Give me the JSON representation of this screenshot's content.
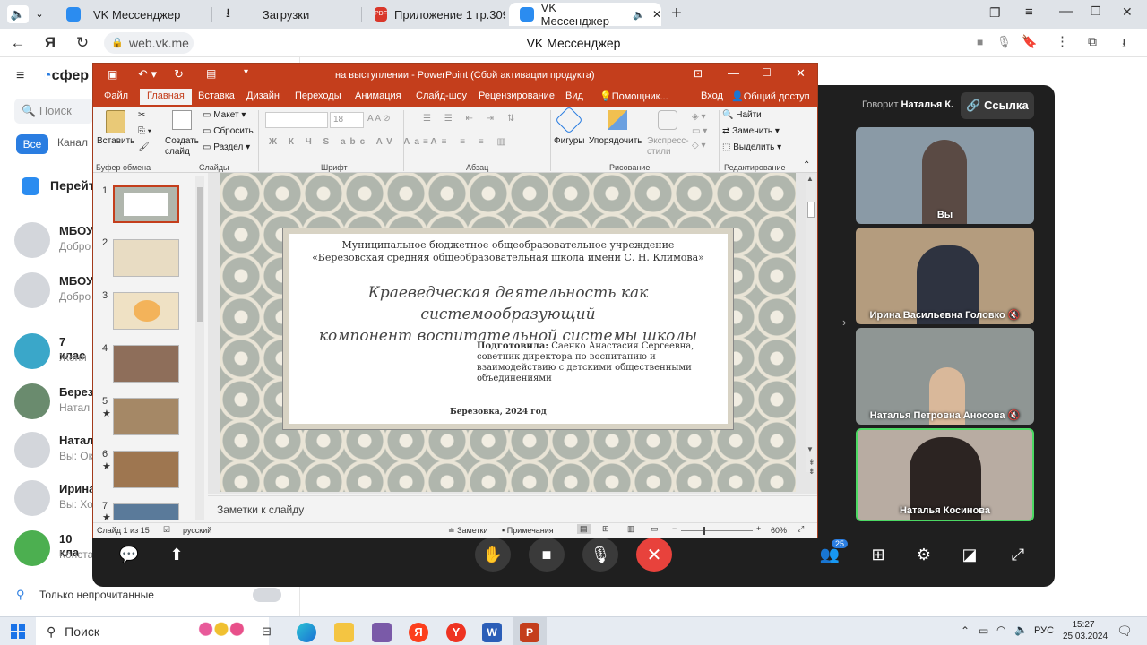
{
  "browser": {
    "tabs": [
      {
        "label": "VK Мессенджер"
      },
      {
        "label": "Загрузки"
      },
      {
        "label": "Приложение 1 гр.309-24"
      },
      {
        "label": "VK Мессенджер"
      }
    ],
    "url": "web.vk.me",
    "page_title": "VK Мессенджер"
  },
  "vk": {
    "logo": "сфер",
    "search_placeholder": "Поиск",
    "filters": [
      "Все",
      "Канал"
    ],
    "goto": "Перейт",
    "chats": [
      {
        "name": "МБОУ",
        "sub": "Добро"
      },
      {
        "name": "МБОУ",
        "sub": "Добро"
      },
      {
        "name": "7 клас",
        "sub": "Женя"
      },
      {
        "name": "Берез",
        "sub": "Натал"
      },
      {
        "name": "Натал",
        "sub": "Вы: Ок"
      },
      {
        "name": "Ирина",
        "sub": "Вы: Хо"
      },
      {
        "name": "10 кла",
        "sub": "Конста"
      }
    ],
    "unread_only": "Только непрочитанные"
  },
  "call": {
    "speaking_label": "Говорит",
    "speaker": "Наталья К.",
    "link_button": "Ссылка",
    "participants_count": "25",
    "tiles": [
      {
        "name": "Вы",
        "bg": "#8a9aa6"
      },
      {
        "name": "Ирина Васильевна Головко",
        "bg": "#b49c7e"
      },
      {
        "name": "Наталья Петровна Аносова",
        "bg": "#8f9694"
      },
      {
        "name": "Наталья Косинова",
        "bg": "#b8aca2"
      }
    ]
  },
  "ppt": {
    "title": "на выступлении - PowerPoint (Сбой активации продукта)",
    "menu": [
      "Файл",
      "Главная",
      "Вставка",
      "Дизайн",
      "Переходы",
      "Анимация",
      "Слайд-шоу",
      "Рецензирование",
      "Вид",
      "Помощник...",
      "Вход",
      "Общий доступ"
    ],
    "ribbon": {
      "paste": "Вставить",
      "new_slide": "Создать слайд",
      "layout": "Макет",
      "reset": "Сбросить",
      "section": "Раздел",
      "font_size": "18",
      "shapes": "Фигуры",
      "arrange": "Упорядочить",
      "quick_styles": "Экспресс-стили",
      "find": "Найти",
      "replace": "Заменить",
      "select": "Выделить",
      "groups": [
        "Буфер обмена",
        "Слайды",
        "Шрифт",
        "Абзац",
        "Рисование",
        "Редактирование"
      ]
    },
    "thumb_numbers": [
      "1",
      "2",
      "3",
      "4",
      "5",
      "6",
      "7"
    ],
    "slide": {
      "org_line1": "Муниципальное бюджетное общеобразовательное учреждение",
      "org_line2": "«Березовская средняя общеобразовательная школа имени С. Н. Климова»",
      "title_line1": "Краеведческая деятельность как системообразующий",
      "title_line2": "компонент воспитательной системы школы",
      "prepared_label": "Подготовила:",
      "prepared_line1": " Саенко Анастасия Сергеевна,",
      "prepared_line2": "советник директора по воспитанию и",
      "prepared_line3": "взаимодействию с детскими общественными",
      "prepared_line4": "объединениями",
      "footer": "Березовка, 2024 год"
    },
    "notes_placeholder": "Заметки к слайду",
    "status": {
      "slide": "Слайд 1 из 15",
      "lang": "русский",
      "notes": "Заметки",
      "comments": "Примечания",
      "zoom": "60%"
    }
  },
  "taskbar": {
    "search": "Поиск",
    "lang": "РУС",
    "time": "15:27",
    "date": "25.03.2024"
  }
}
